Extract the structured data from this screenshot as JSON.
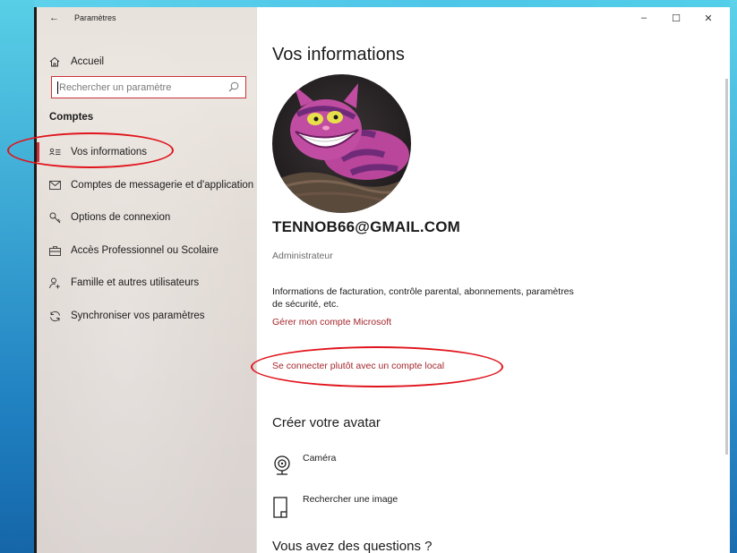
{
  "window": {
    "app_title": "Paramètres",
    "controls": {
      "minimize": "–",
      "maximize": "☐",
      "close": "✕"
    }
  },
  "sidebar": {
    "home_label": "Accueil",
    "search_placeholder": "Rechercher un paramètre",
    "section_title": "Comptes",
    "items": [
      {
        "label": "Vos informations",
        "icon": "person-card-icon",
        "selected": true
      },
      {
        "label": "Comptes de messagerie et d'application",
        "icon": "mail-icon"
      },
      {
        "label": "Options de connexion",
        "icon": "key-icon"
      },
      {
        "label": "Accès Professionnel ou Scolaire",
        "icon": "briefcase-icon"
      },
      {
        "label": "Famille et autres utilisateurs",
        "icon": "add-person-icon"
      },
      {
        "label": "Synchroniser vos paramètres",
        "icon": "sync-icon"
      }
    ]
  },
  "main": {
    "page_title": "Vos informations",
    "account_email": "TENNOB66@GMAIL.COM",
    "role": "Administrateur",
    "billing_info": "Informations de facturation, contrôle parental, abonnements, paramètres de sécurité, etc.",
    "manage_link": "Gérer mon compte Microsoft",
    "local_account_link": "Se connecter plutôt avec un compte local",
    "avatar_section_title": "Créer votre avatar",
    "avatar_options": [
      {
        "label": "Caméra",
        "icon": "camera-icon"
      },
      {
        "label": "Rechercher une image",
        "icon": "browse-image-icon"
      }
    ],
    "questions_title": "Vous avez des questions ?"
  },
  "colors": {
    "accent": "#c8323a",
    "link": "#a4262c",
    "annotation": "#e0141c"
  }
}
